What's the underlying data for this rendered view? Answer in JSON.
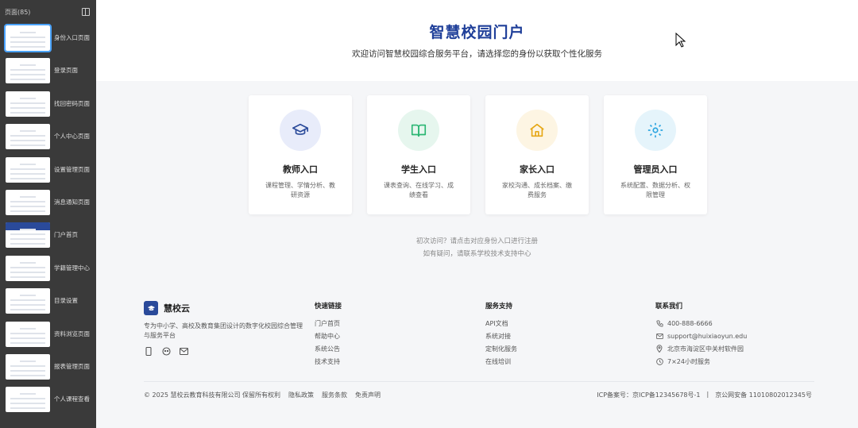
{
  "sidebar": {
    "title": "页面(85)",
    "pages": [
      {
        "label": "身份入口页面"
      },
      {
        "label": "登录页面"
      },
      {
        "label": "找回密码页面"
      },
      {
        "label": "个人中心页面"
      },
      {
        "label": "设置管理页面"
      },
      {
        "label": "消息通知页面"
      },
      {
        "label": "门户首页"
      },
      {
        "label": "学籍管理中心"
      },
      {
        "label": "目录设置"
      },
      {
        "label": "资料浏览页面"
      },
      {
        "label": "报表管理页面"
      },
      {
        "label": "个人课程查看"
      }
    ]
  },
  "hero": {
    "title": "智慧校园门户",
    "subtitle": "欢迎访问智慧校园综合服务平台，请选择您的身份以获取个性化服务"
  },
  "cards": [
    {
      "title": "教师入口",
      "desc": "课程管理、学情分析、教研资源",
      "bg": "#e8ecfa",
      "color": "#2a4a9a",
      "icon": "graduation-cap-icon"
    },
    {
      "title": "学生入口",
      "desc": "课表查询、在线学习、成绩查看",
      "bg": "#e6f6ee",
      "color": "#2bb673",
      "icon": "book-icon"
    },
    {
      "title": "家长入口",
      "desc": "家校沟通、成长档案、缴费服务",
      "bg": "#fdf5e3",
      "color": "#e6a817",
      "icon": "home-icon"
    },
    {
      "title": "管理员入口",
      "desc": "系统配置、数据分析、权限管理",
      "bg": "#e5f4fb",
      "color": "#2ca5e0",
      "icon": "gear-icon"
    }
  ],
  "hints": {
    "line1": "初次访问？请点击对应身份入口进行注册",
    "line2": "如有疑问，请联系学校技术支持中心"
  },
  "footer": {
    "brand": "慧校云",
    "description": "专为中小学、高校及教育集团设计的数字化校园综合管理与服务平台",
    "columns": [
      {
        "heading": "快速链接",
        "links": [
          "门户首页",
          "帮助中心",
          "系统公告",
          "技术支持"
        ]
      },
      {
        "heading": "服务支持",
        "links": [
          "API文档",
          "系统对接",
          "定制化服务",
          "在线培训"
        ]
      },
      {
        "heading": "联系我们",
        "links": [
          "400-888-6666",
          "support@huixiaoyun.edu",
          "北京市海淀区中关村软件园",
          "7×24小时服务"
        ]
      }
    ],
    "copyright": "© 2025 慧校云教育科技有限公司 保留所有权利",
    "legal": [
      "隐私政策",
      "服务条款",
      "免责声明"
    ],
    "icp": "ICP备案号：京ICP备12345678号-1",
    "police": "京公网安备 11010802012345号"
  }
}
